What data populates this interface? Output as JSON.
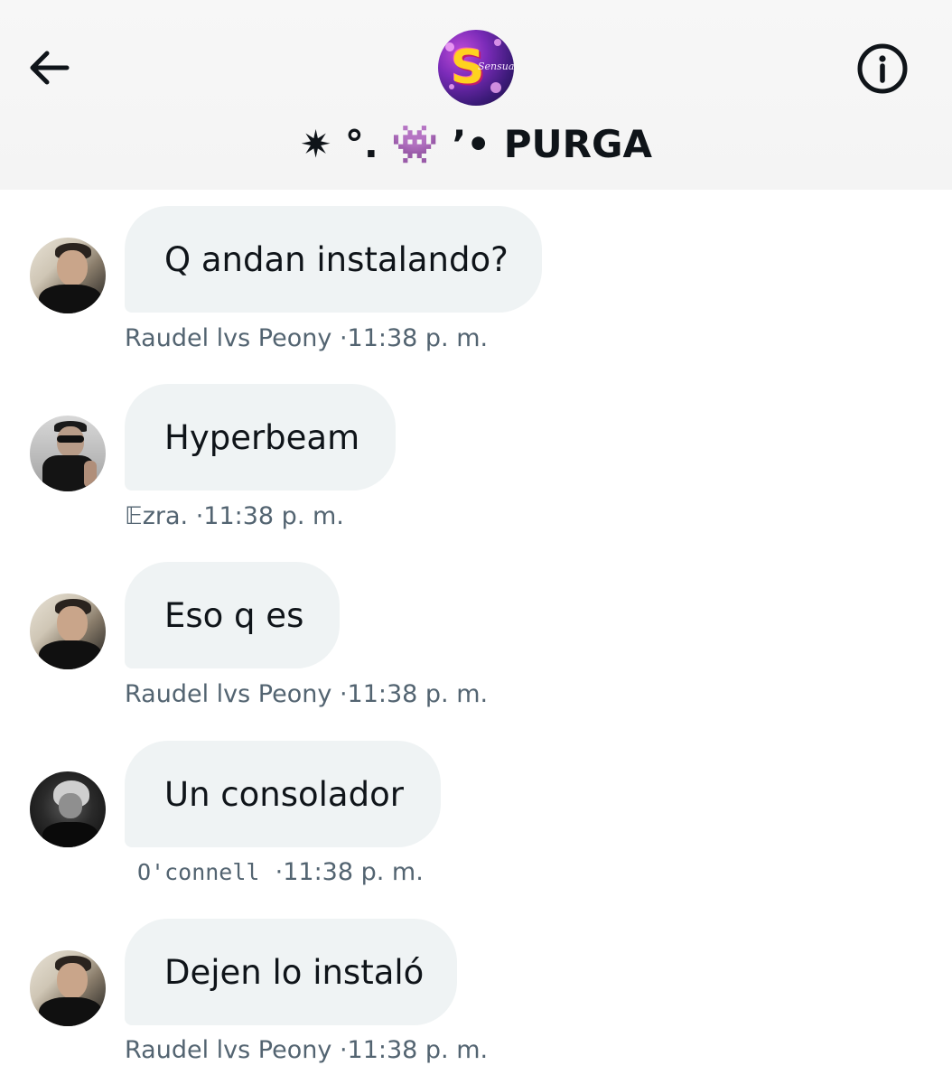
{
  "header": {
    "back_icon": "arrow-left-icon",
    "info_icon": "info-circle-icon",
    "group_avatar_letter": "S",
    "group_avatar_script": "Sensualfy",
    "group_name_prefix": "✷ °. ",
    "group_name_emoji": "👾",
    "group_name_suffix": " ’• PURGA"
  },
  "messages": [
    {
      "text": "Q andan instalando?",
      "sender": "Raudel lvs Peony",
      "time": "·11:38 p. m."
    },
    {
      "text": "Hyperbeam",
      "sender": "𝔼zra.",
      "time": "·11:38 p. m."
    },
    {
      "text": "Eso q es",
      "sender": "Raudel lvs Peony",
      "time": "·11:38 p. m."
    },
    {
      "text": "Un consolador",
      "sender": "O'connell",
      "time": "·11:38 p. m."
    },
    {
      "text": "Dejen lo instaló",
      "sender": "Raudel lvs Peony",
      "time": "·11:38 p. m."
    }
  ]
}
